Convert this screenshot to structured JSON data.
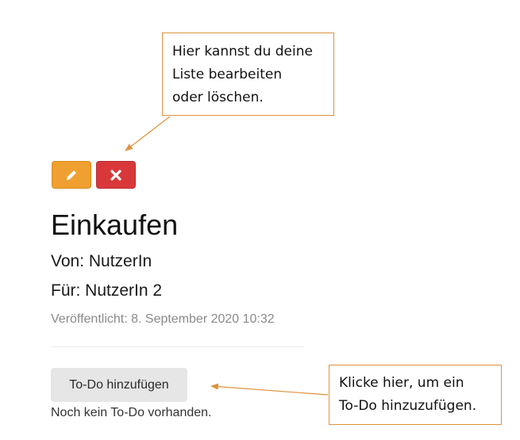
{
  "annotations": {
    "edit_delete_hint": "Hier kannst du deine\nListe bearbeiten\noder löschen.",
    "add_todo_hint": "Klicke hier, um ein\nTo-Do hinzuzufügen.",
    "accent_color": "#e0913d"
  },
  "toolbar": {
    "edit_icon": "pencil-icon",
    "delete_icon": "x-icon",
    "edit_color": "#f0a030",
    "delete_color": "#d9383a"
  },
  "list": {
    "title": "Einkaufen",
    "from": "Von: NutzerIn",
    "for": "Für: NutzerIn 2",
    "published": "Veröffentlicht: 8. September 2020 10:32"
  },
  "todos": {
    "add_label": "To-Do hinzufügen",
    "empty_text": "Noch kein To-Do vorhanden."
  }
}
